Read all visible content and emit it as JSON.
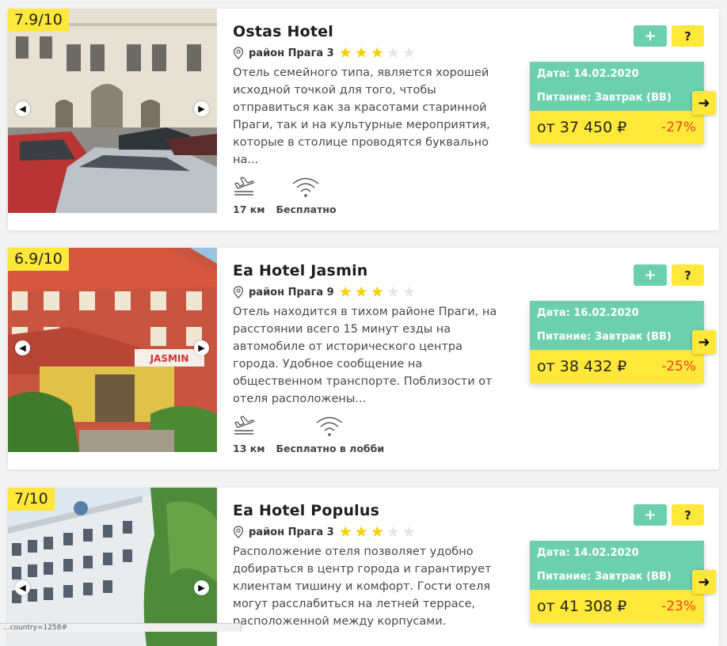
{
  "hotels": [
    {
      "rating": "7.9/10",
      "name": "Ostas Hotel",
      "district": "район Прага 3",
      "stars_filled": 3,
      "stars_total": 5,
      "description": "Отель семейного типа, является хорошей исходной точкой для того, чтобы отправиться как за красотами старинной Праги, так и на культурные мероприятия, которые в столице проводятся буквально на...",
      "airport_distance": "17 км",
      "wifi": "Бесплатно",
      "plus_label": "+",
      "question_label": "?",
      "date": "Дата: 14.02.2020",
      "meal": "Питание: Завтрак (BB)",
      "price": "от 37 450 ₽",
      "discount": "-27%"
    },
    {
      "rating": "6.9/10",
      "name": "Ea Hotel Jasmin",
      "district": "район Прага 9",
      "stars_filled": 3,
      "stars_total": 5,
      "description": "Отель находится в тихом районе Праги, на расстоянии всего 15 минут езды на автомобиле от исторического центра города. Удобное сообщение на общественном транспорте. Поблизости от отеля расположены...",
      "airport_distance": "13 км",
      "wifi": "Бесплатно в лобби",
      "plus_label": "+",
      "question_label": "?",
      "date": "Дата: 16.02.2020",
      "meal": "Питание: Завтрак (BB)",
      "price": "от 38 432 ₽",
      "discount": "-25%",
      "sign_text": "JASMIN"
    },
    {
      "rating": "7/10",
      "name": "Ea Hotel Populus",
      "district": "район Прага 3",
      "stars_filled": 3,
      "stars_total": 5,
      "description": "Расположение отеля позволяет удобно добираться в центр города и гарантирует клиентам тишину и комфорт. Гости отеля могут расслабиться на летней террасе, расположенной между корпусами.",
      "airport_distance": "",
      "wifi": "",
      "plus_label": "+",
      "question_label": "?",
      "date": "Дата: 14.02.2020",
      "meal": "Питание: Завтрак (BB)",
      "price": "от 41 308 ₽",
      "discount": "-23%"
    }
  ],
  "icons": {
    "prev": "chevron-left-icon",
    "next": "chevron-right-icon",
    "go": "arrow-right-icon",
    "plane": "airplane-landing-icon",
    "wifi": "wifi-icon",
    "pin": "map-pin-icon"
  },
  "status_url": "...country=1258#",
  "colors": {
    "accent_green": "#6ccfae",
    "accent_yellow": "#ffe83a",
    "discount_red": "#e8452c",
    "star_gold": "#f5d000"
  }
}
